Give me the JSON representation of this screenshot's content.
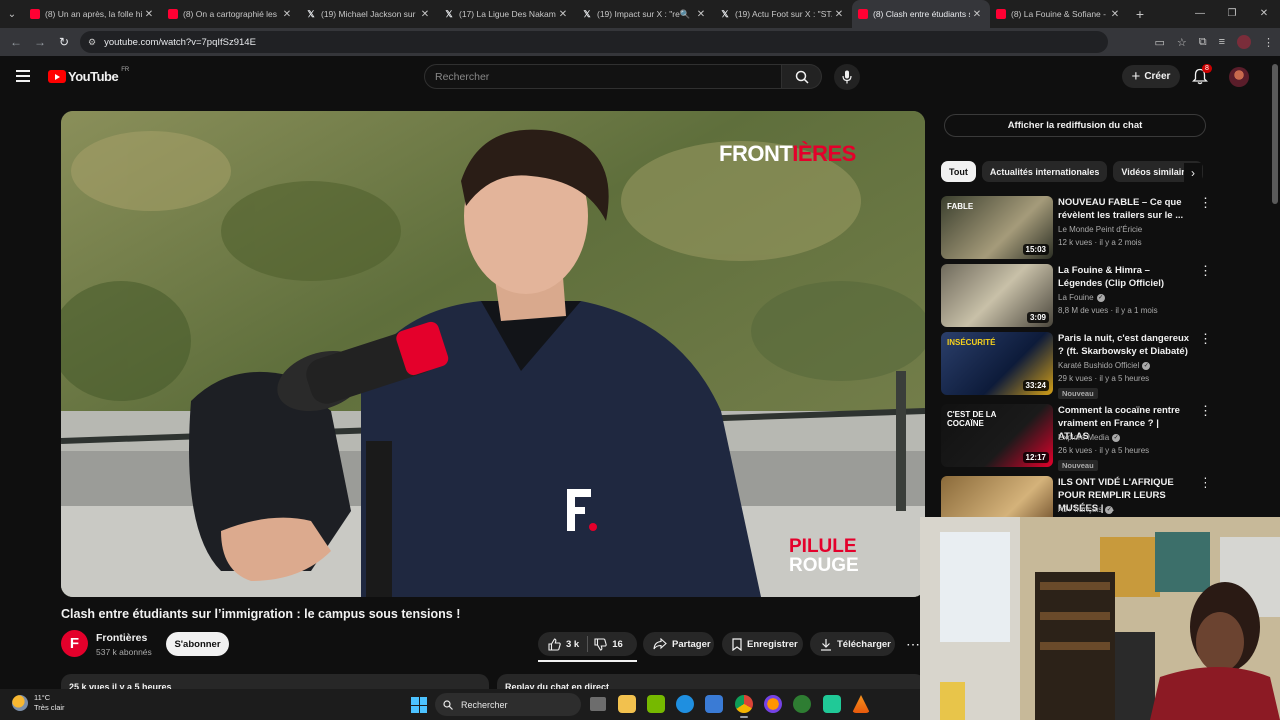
{
  "browser": {
    "tabs": [
      {
        "icon": "youtube-icon",
        "title": "(8) Un an après, la folle hi",
        "active": false
      },
      {
        "icon": "youtube-icon",
        "title": "(8) On a cartographié les",
        "active": false
      },
      {
        "icon": "x-icon",
        "title": "(19) Michael Jackson sur X",
        "active": false
      },
      {
        "icon": "x-icon",
        "title": "(17) La Ligue Des Nakama",
        "active": false
      },
      {
        "icon": "x-icon",
        "title": "(19) Impact sur X : \"re🔍",
        "active": false
      },
      {
        "icon": "x-icon",
        "title": "(19) Actu Foot sur X : \"ST/",
        "active": false
      },
      {
        "icon": "youtube-icon",
        "title": "(8) Clash entre étudiants s",
        "active": true
      },
      {
        "icon": "youtube-icon",
        "title": "(8) La Fouine & Sofiane -",
        "active": false
      }
    ],
    "url": "youtube.com/watch?v=7pqIfSz914E"
  },
  "youtube": {
    "logo_text": "YouTube",
    "country_code": "FR",
    "search_placeholder": "Rechercher",
    "create_label": "Créer",
    "notif_count": "8"
  },
  "video": {
    "watermark_top_a": "FRONT",
    "watermark_top_b": "IÈRES",
    "watermark_bottom_1": "PILULE",
    "watermark_bottom_2": "ROUGE",
    "title": "Clash entre étudiants sur l’immigration : le campus sous tensions !",
    "channel_name": "Frontières",
    "channel_initial": "F",
    "subscribers": "537 k abonnés",
    "subscribe_label": "S'abonner",
    "likes": "3 k",
    "dislikes": "16",
    "share_label": "Partager",
    "save_label": "Enregistrer",
    "download_label": "Télécharger",
    "views_meta": "25 k vues  il y a 5 heures",
    "chat_replay_box": "Replay du chat en direct"
  },
  "sidebar": {
    "chat_replay_button": "Afficher la rediffusion du chat",
    "chips": [
      "Tout",
      "Actualités internationales",
      "Vidéos similaires"
    ],
    "recommendations": [
      {
        "title": "NOUVEAU FABLE – Ce que révèlent les trailers sur le ...",
        "channel": "Le Monde Peint d'Éricie",
        "verified": false,
        "meta": "12 k vues · il y a 2 mois",
        "duration": "15:03",
        "badge": "",
        "thumb_text": "FABLE"
      },
      {
        "title": "La Fouine & Himra – Légendes (Clip Officiel)",
        "channel": "La Fouine",
        "verified": true,
        "meta": "8,8 M de vues · il y a 1 mois",
        "duration": "3:09",
        "badge": "",
        "thumb_text": ""
      },
      {
        "title": "Paris la nuit, c'est dangereux ? (ft. Skarbowsky et Diabaté)",
        "channel": "Karaté Bushido Officiel",
        "verified": true,
        "meta": "29 k vues · il y a 5 heures",
        "duration": "33:24",
        "badge": "Nouveau",
        "thumb_text": "INSÉCURITÉ"
      },
      {
        "title": "Comment la cocaïne rentre vraiment en France ? | ATLAS",
        "channel": "Explore Media",
        "verified": true,
        "meta": "26 k vues · il y a 5 heures",
        "duration": "12:17",
        "badge": "Nouveau",
        "thumb_text": "C'EST DE LA COCAÏNE"
      },
      {
        "title": "ILS ONT VIDÉ L'AFRIQUE POUR REMPLIR LEURS MUSÉES | ...",
        "channel": "AJ+ français",
        "verified": true,
        "meta": "",
        "duration": "",
        "badge": "",
        "thumb_text": ""
      }
    ]
  },
  "taskbar": {
    "temperature": "11°C",
    "weather": "Très clair",
    "search_label": "Rechercher"
  },
  "colors": {
    "youtube_red": "#ff0000",
    "frontieres_red": "#e4002b",
    "background": "#0f0f0f"
  }
}
